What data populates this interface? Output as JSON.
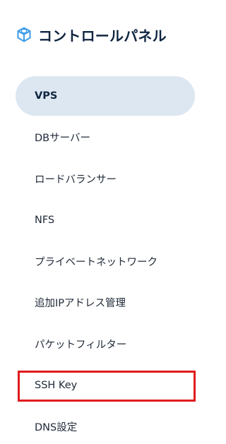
{
  "brand": {
    "icon": "cube-network-icon",
    "title": "コントロールパネル",
    "icon_color": "#3d9be9"
  },
  "nav": {
    "items": [
      {
        "name": "nav-item-vps",
        "label": "VPS",
        "active": true
      },
      {
        "name": "nav-item-db-server",
        "label": "DBサーバー"
      },
      {
        "name": "nav-item-load-balancer",
        "label": "ロードバランサー"
      },
      {
        "name": "nav-item-nfs",
        "label": "NFS"
      },
      {
        "name": "nav-item-private-network",
        "label": "プライベートネットワーク"
      },
      {
        "name": "nav-item-additional-ip",
        "label": "追加IPアドレス管理"
      },
      {
        "name": "nav-item-packet-filter",
        "label": "パケットフィルター"
      },
      {
        "name": "nav-item-ssh-key",
        "label": "SSH Key",
        "highlighted": true
      },
      {
        "name": "nav-item-dns",
        "label": "DNS設定"
      }
    ]
  },
  "colors": {
    "active_bg": "#dce7f1",
    "highlight_border": "#e01b1b",
    "title_text": "#0f2540"
  }
}
